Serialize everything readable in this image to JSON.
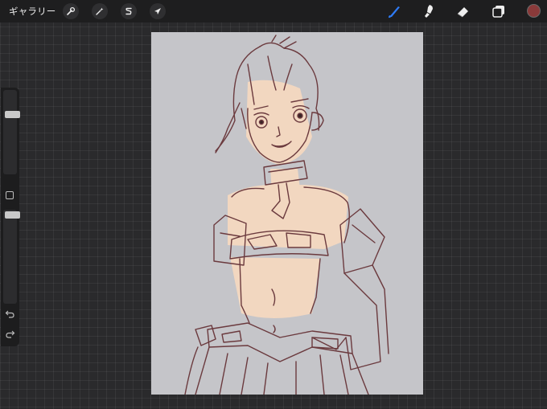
{
  "topbar": {
    "gallery_label": "ギャラリー",
    "left_tools": [
      {
        "name": "actions",
        "icon": "wrench-icon"
      },
      {
        "name": "adjustments",
        "icon": "magic-wand-icon"
      },
      {
        "name": "selection",
        "icon": "selection-s-icon"
      },
      {
        "name": "transform",
        "icon": "arrow-cursor-icon"
      }
    ],
    "right_tools": [
      {
        "name": "brush",
        "icon": "brush-icon",
        "active": true
      },
      {
        "name": "smudge",
        "icon": "smudge-icon",
        "active": false
      },
      {
        "name": "eraser",
        "icon": "eraser-icon",
        "active": false
      },
      {
        "name": "layers",
        "icon": "layers-icon",
        "active": false
      }
    ],
    "current_color": "#8a3a3a",
    "active_tool_color": "#2f7cf6"
  },
  "sidebar": {
    "brush_size_level": 0.73,
    "opacity_level": 0.98,
    "modify_icon": "square-modify-icon",
    "undo_icon": "undo-icon",
    "redo_icon": "redo-icon"
  },
  "canvas": {
    "background_color": "#c5c5c9",
    "line_color": "#6b3a3e",
    "skin_color": "#f2d7c0",
    "content": "character-sketch"
  }
}
